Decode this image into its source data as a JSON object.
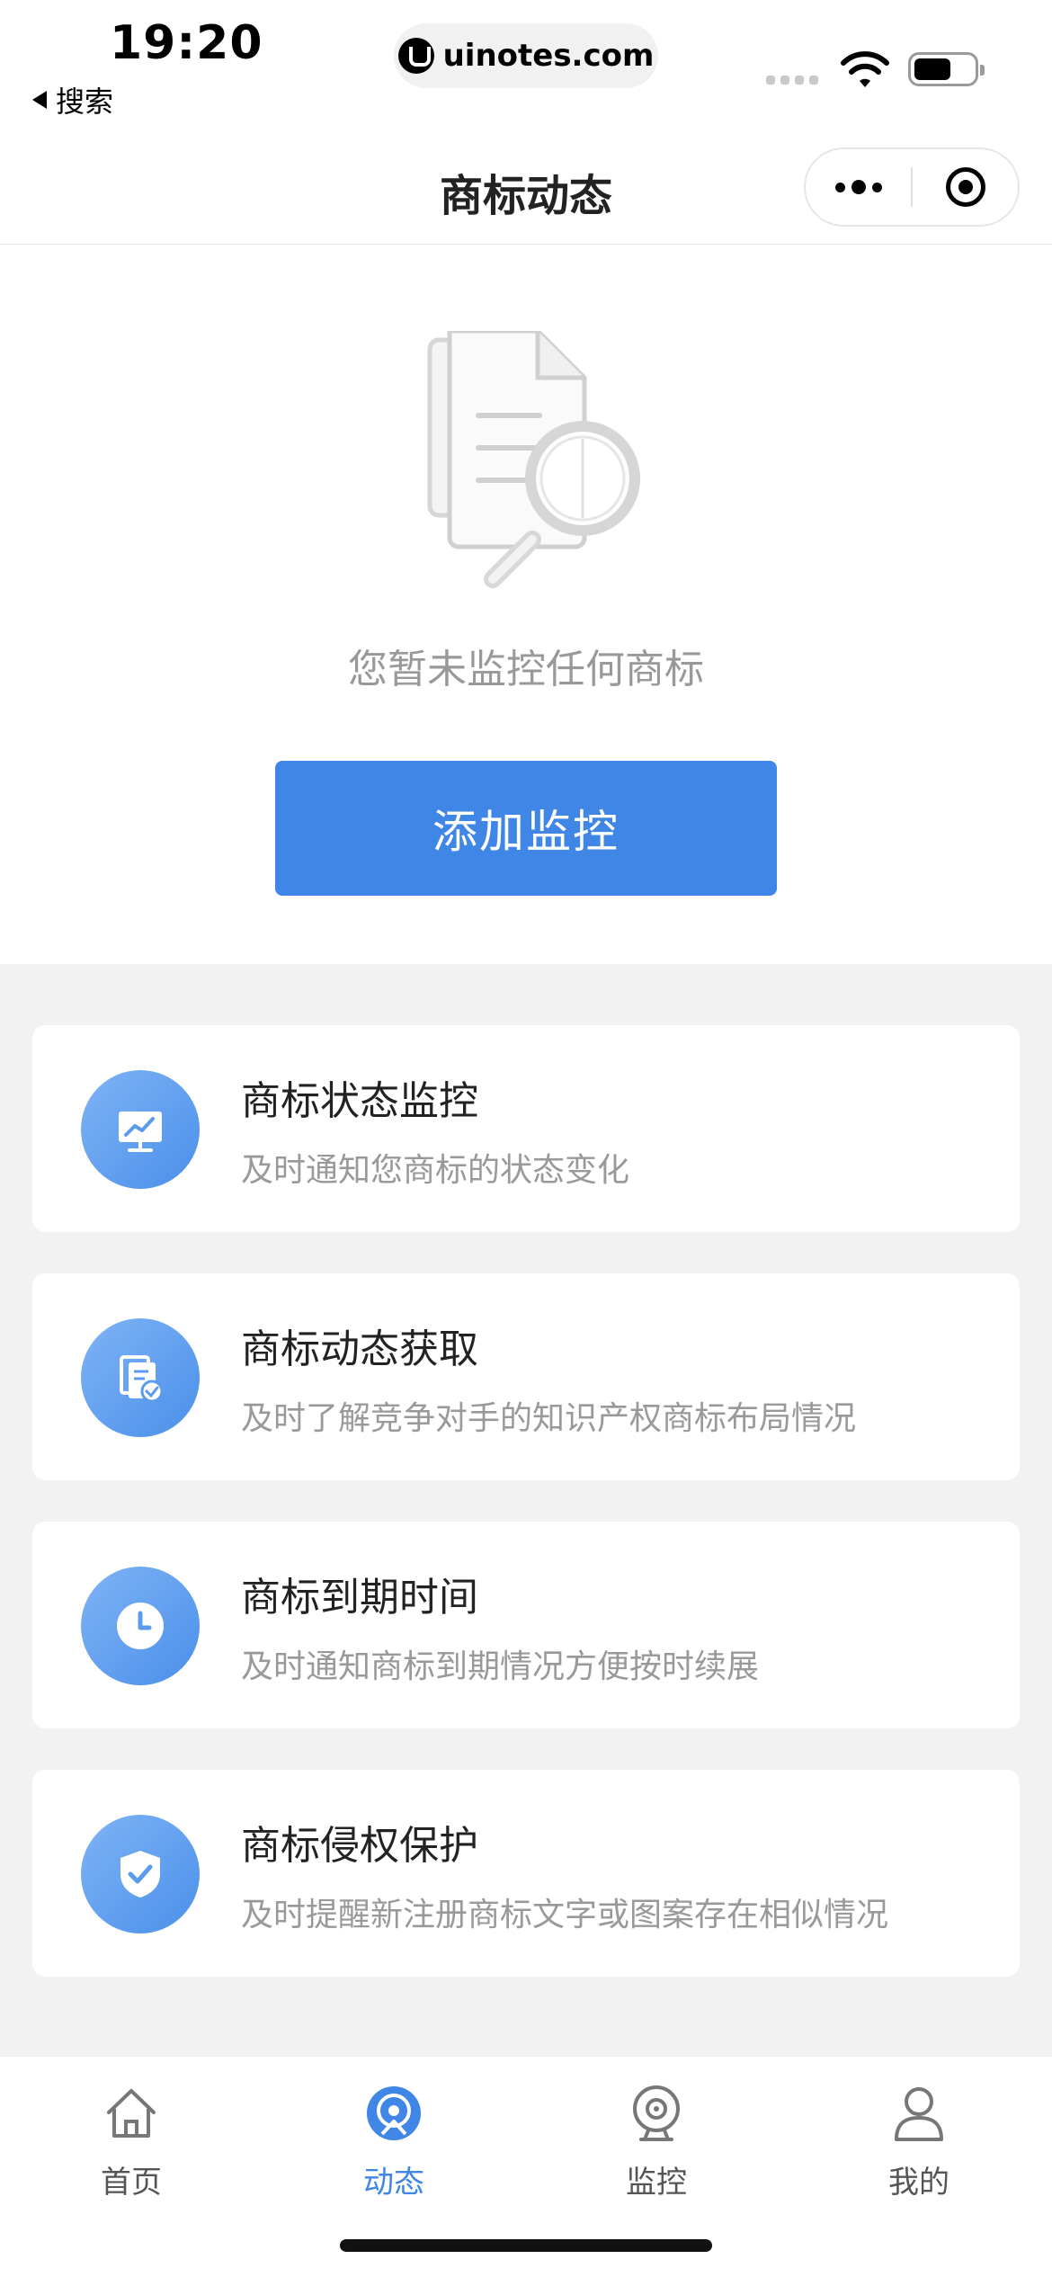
{
  "status_bar": {
    "time": "19:20",
    "back_label": "搜索",
    "url": "uinotes.com"
  },
  "nav": {
    "title": "商标动态"
  },
  "empty_state": {
    "message": "您暂未监控任何商标",
    "button_label": "添加监控",
    "illustration": "document-magnifier-icon"
  },
  "features": [
    {
      "title": "商标状态监控",
      "description": "及时通知您商标的状态变化",
      "icon": "chart-monitor-icon"
    },
    {
      "title": "商标动态获取",
      "description": "及时了解竞争对手的知识产权商标布局情况",
      "icon": "documents-check-icon"
    },
    {
      "title": "商标到期时间",
      "description": "及时通知商标到期情况方便按时续展",
      "icon": "clock-icon"
    },
    {
      "title": "商标侵权保护",
      "description": "及时提醒新注册商标文字或图案存在相似情况",
      "icon": "shield-check-icon"
    }
  ],
  "tab_bar": {
    "items": [
      {
        "label": "首页",
        "icon": "home-icon",
        "active": false
      },
      {
        "label": "动态",
        "icon": "dynamic-icon",
        "active": true
      },
      {
        "label": "监控",
        "icon": "camera-icon",
        "active": false
      },
      {
        "label": "我的",
        "icon": "user-icon",
        "active": false
      }
    ]
  },
  "colors": {
    "accent": "#3f86e6",
    "icon_gradient_start": "#7fb3f5",
    "icon_gradient_end": "#4a90ea",
    "background": "#f2f2f2"
  }
}
